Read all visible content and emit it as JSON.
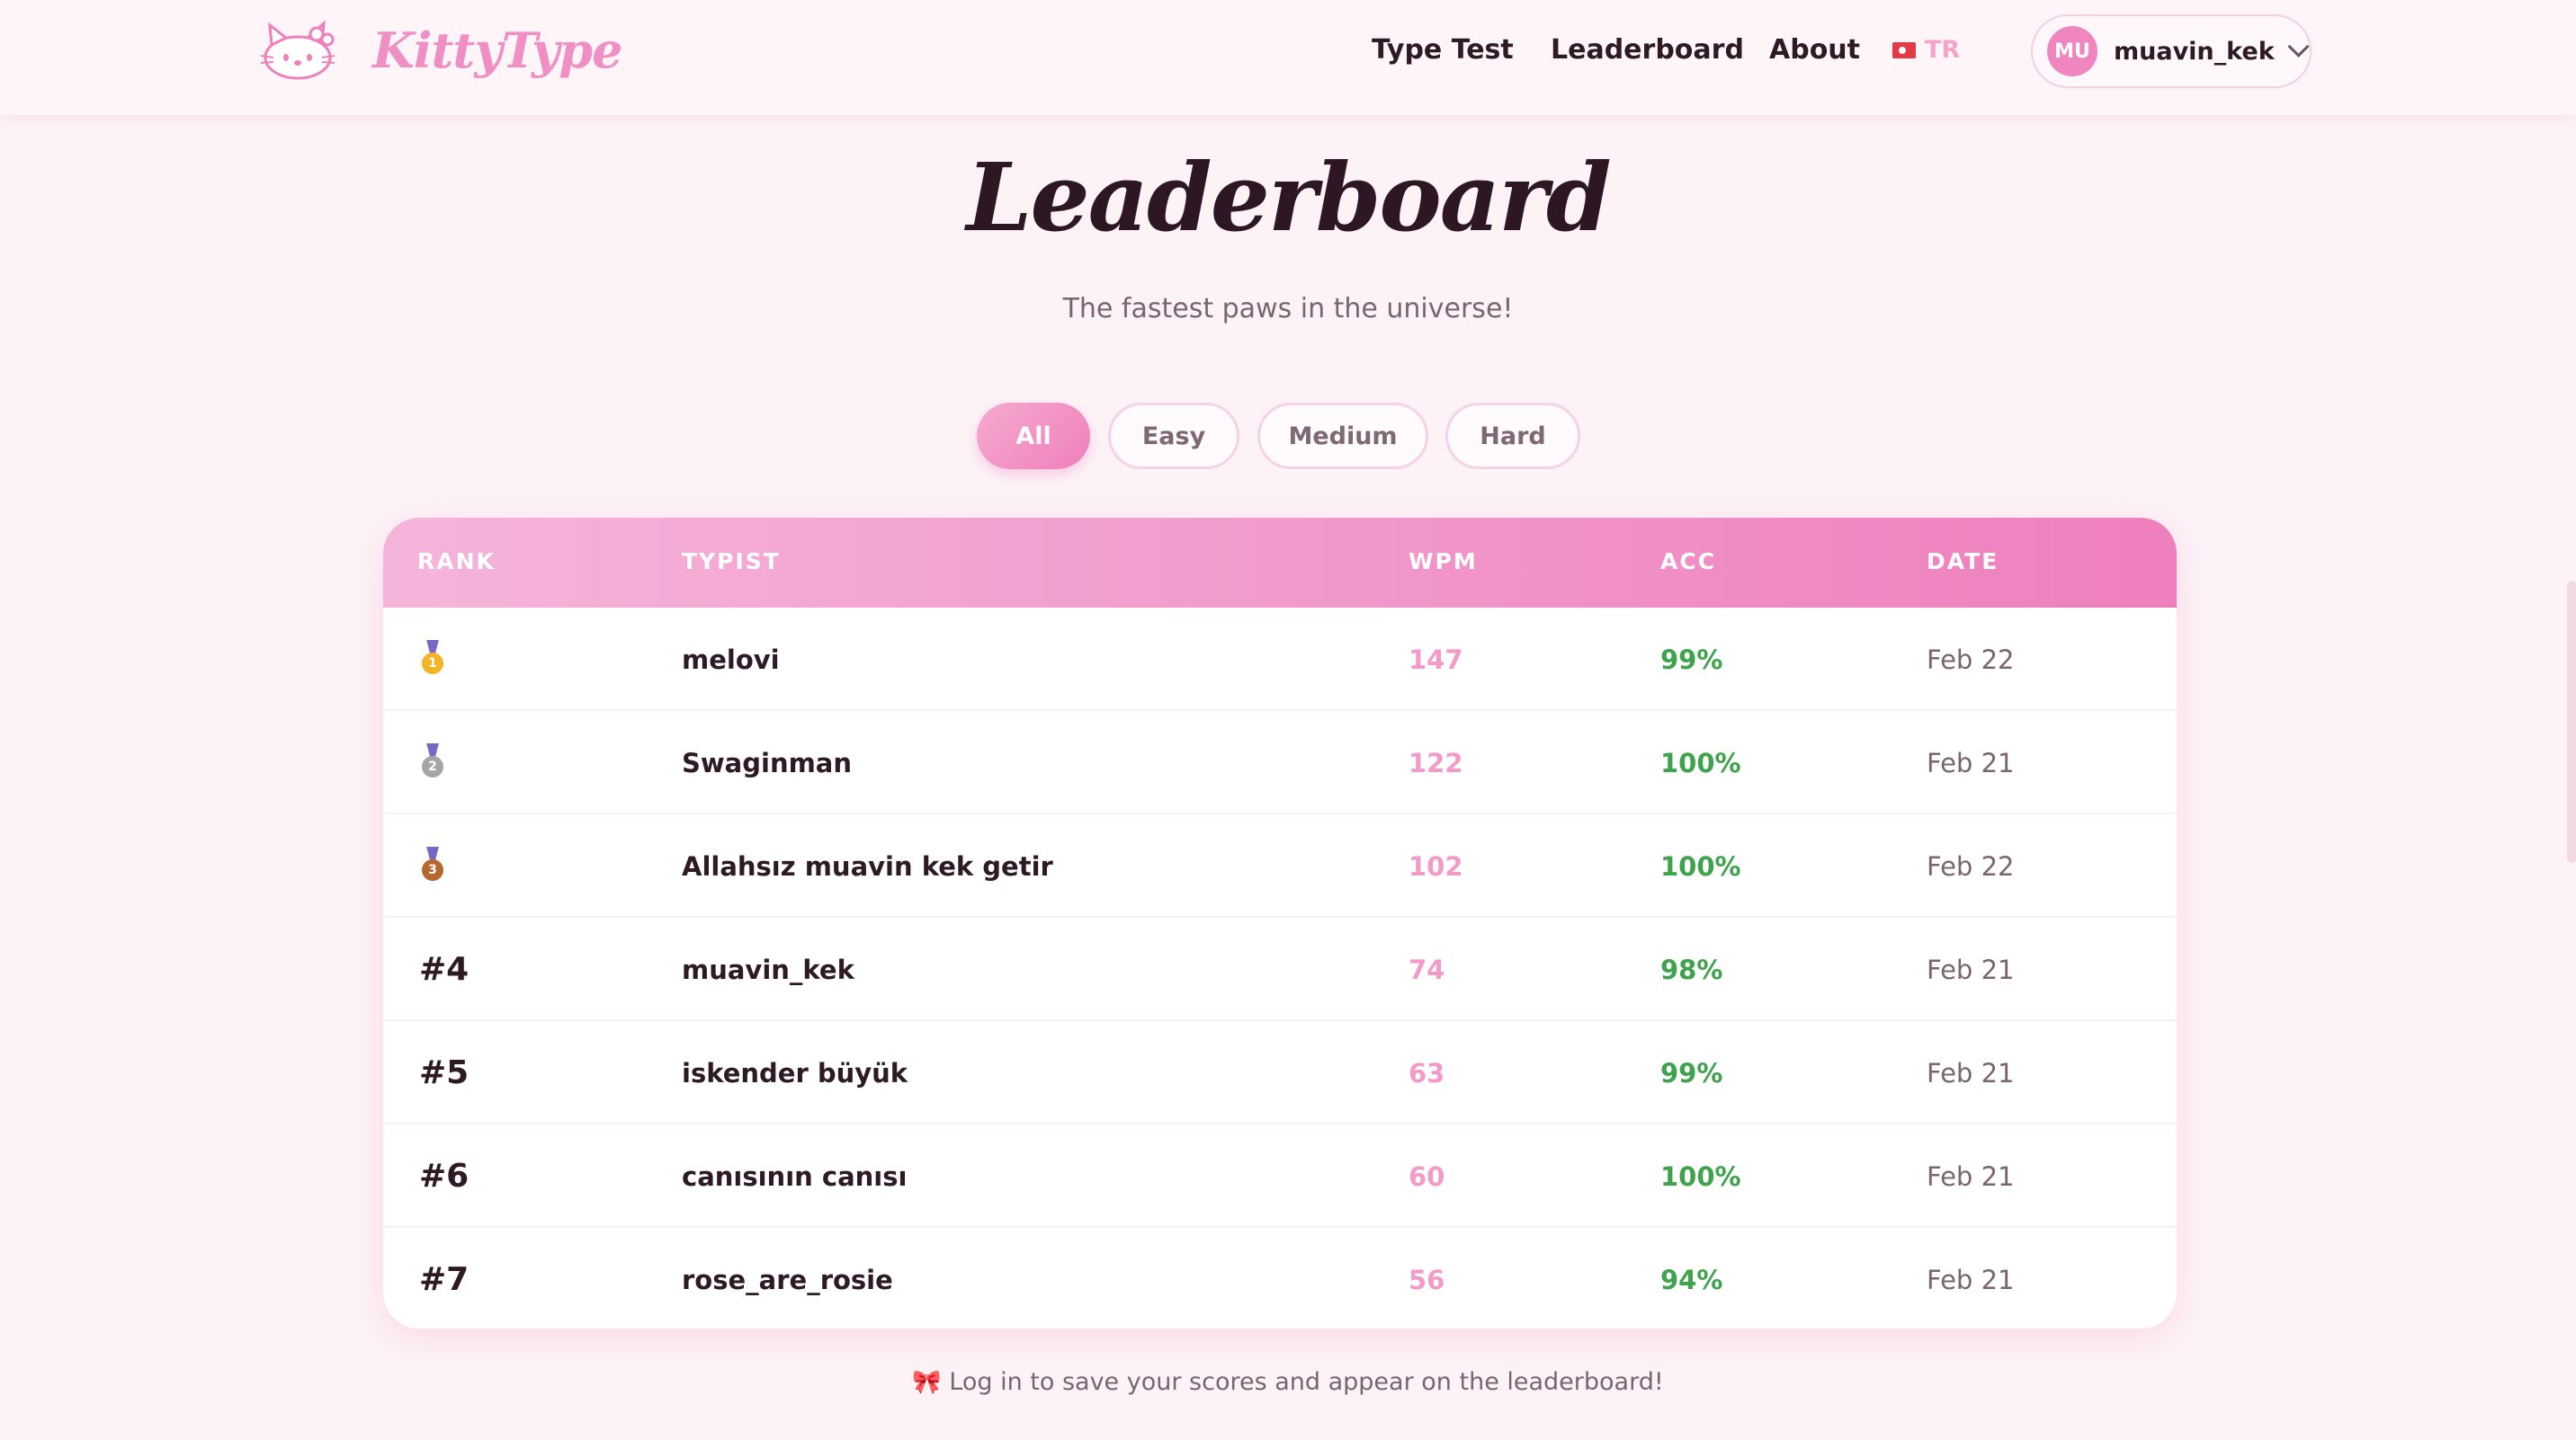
{
  "app": {
    "name": "KittyType"
  },
  "nav": {
    "links": [
      "Type Test",
      "Leaderboard",
      "About"
    ],
    "language": "TR",
    "user": {
      "initials": "MU",
      "username": "muavin_kek"
    }
  },
  "page": {
    "title": "Leaderboard",
    "subtitle": "The fastest paws in the universe!"
  },
  "filters": {
    "options": [
      "All",
      "Easy",
      "Medium",
      "Hard"
    ],
    "selected": "All"
  },
  "table": {
    "headers": {
      "rank": "RANK",
      "typist": "TYPIST",
      "wpm": "WPM",
      "acc": "ACC",
      "date": "DATE"
    },
    "rows": [
      {
        "rank": "1",
        "medal": "gold-medal-icon",
        "typist": "melovi",
        "wpm": "147",
        "acc": "99%",
        "date": "Feb 22"
      },
      {
        "rank": "2",
        "medal": "silver-medal-icon",
        "typist": "Swaginman",
        "wpm": "122",
        "acc": "100%",
        "date": "Feb 21"
      },
      {
        "rank": "3",
        "medal": "bronze-medal-icon",
        "typist": "Allahsız muavin kek getir",
        "wpm": "102",
        "acc": "100%",
        "date": "Feb 22"
      },
      {
        "rank": "#4",
        "medal": null,
        "typist": "muavin_kek",
        "wpm": "74",
        "acc": "98%",
        "date": "Feb 21"
      },
      {
        "rank": "#5",
        "medal": null,
        "typist": "iskender büyük",
        "wpm": "63",
        "acc": "99%",
        "date": "Feb 21"
      },
      {
        "rank": "#6",
        "medal": null,
        "typist": "canısının canısı",
        "wpm": "60",
        "acc": "100%",
        "date": "Feb 21"
      },
      {
        "rank": "#7",
        "medal": null,
        "typist": "rose_are_rosie",
        "wpm": "56",
        "acc": "94%",
        "date": "Feb 21"
      }
    ]
  },
  "footer": {
    "note": "Log in to save your scores and appear on the leaderboard!",
    "icon": "bow-icon"
  },
  "colors": {
    "accent": "#ee80bb",
    "wpm": "#f29ac8",
    "acc": "#3fa34d",
    "background": "#fdf3f7"
  }
}
